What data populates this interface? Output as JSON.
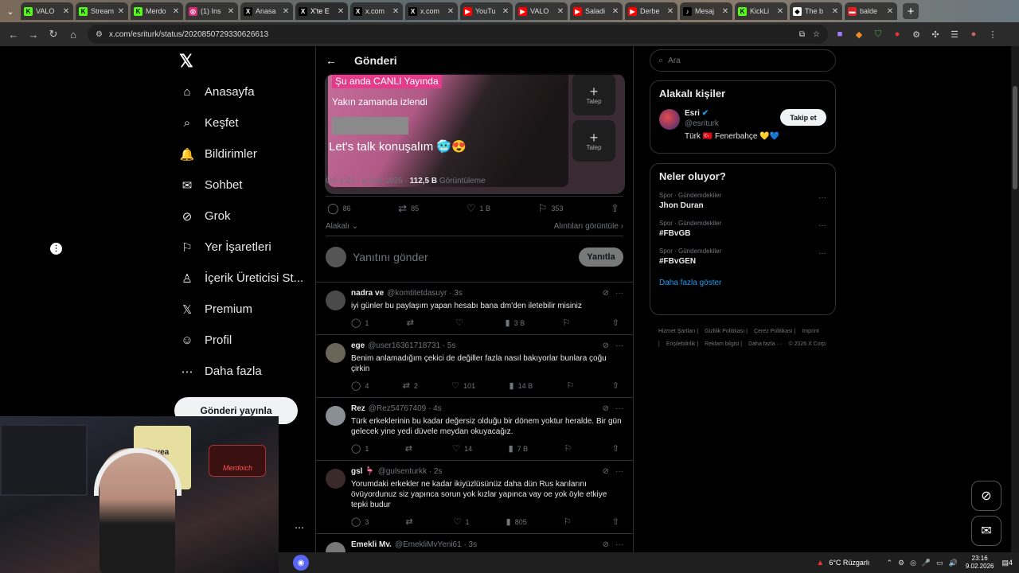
{
  "browser": {
    "tabs": [
      {
        "title": "VALO",
        "fav_bg": "#53fc18",
        "fav_text": "K"
      },
      {
        "title": "Stream",
        "fav_bg": "#53fc18",
        "fav_text": "K"
      },
      {
        "title": "Merdo",
        "fav_bg": "#53fc18",
        "fav_text": "K"
      },
      {
        "title": "(1) Ins",
        "fav_bg": "#d62976",
        "fav_text": "◎"
      },
      {
        "title": "Anasa",
        "fav_bg": "#000000",
        "fav_text": "X"
      },
      {
        "title": "X'te E",
        "fav_bg": "#000000",
        "fav_text": "X",
        "active": true
      },
      {
        "title": "x.com",
        "fav_bg": "#000000",
        "fav_text": "X"
      },
      {
        "title": "x.com",
        "fav_bg": "#000000",
        "fav_text": "X"
      },
      {
        "title": "YouTu",
        "fav_bg": "#ff0000",
        "fav_text": "▶"
      },
      {
        "title": "VALO",
        "fav_bg": "#ff0000",
        "fav_text": "▶"
      },
      {
        "title": "Saladi",
        "fav_bg": "#ff0000",
        "fav_text": "▶"
      },
      {
        "title": "Derbe",
        "fav_bg": "#ff0000",
        "fav_text": "▶"
      },
      {
        "title": "Mesaj",
        "fav_bg": "#000000",
        "fav_text": "♪"
      },
      {
        "title": "KickLi",
        "fav_bg": "#53fc18",
        "fav_text": "K"
      },
      {
        "title": "The b",
        "fav_bg": "#ffffff",
        "fav_text": "◆"
      },
      {
        "title": "balde",
        "fav_bg": "#e02020",
        "fav_text": "▬"
      }
    ],
    "url": "x.com/esriturk/status/2020850729330626613"
  },
  "nav": {
    "items": [
      {
        "label": "Anasayfa",
        "icon": "⌂",
        "name": "home"
      },
      {
        "label": "Keşfet",
        "icon": "⌕",
        "name": "explore"
      },
      {
        "label": "Bildirimler",
        "icon": "🔔",
        "name": "notifications"
      },
      {
        "label": "Sohbet",
        "icon": "✉",
        "name": "chat"
      },
      {
        "label": "Grok",
        "icon": "⊘",
        "name": "grok"
      },
      {
        "label": "Yer İşaretleri",
        "icon": "⚐",
        "name": "bookmarks"
      },
      {
        "label": "İçerik Üreticisi St...",
        "icon": "♙",
        "name": "creator-studio"
      },
      {
        "label": "Premium",
        "icon": "𝕏",
        "name": "premium"
      },
      {
        "label": "Profil",
        "icon": "☺",
        "name": "profile"
      },
      {
        "label": "Daha fazla",
        "icon": "⋯",
        "name": "more"
      }
    ],
    "post_button": "Gönderi yayınla"
  },
  "post": {
    "header_title": "Gönderi",
    "media": {
      "live": "Şu anda CANLI Yayında",
      "watched": "Yakın zamanda izlendi",
      "caption": "Let's talk  konuşalım 🥶😍",
      "request_label": "Talep"
    },
    "time": "ÖS 4:22 · 9 Şub 2026 · ",
    "views": "112,5 B",
    "views_label": "Görüntüleme",
    "stats": {
      "replies": "86",
      "reposts": "85",
      "likes": "1 B",
      "bookmarks": "353"
    },
    "related": "Alakalı",
    "quotes": "Alıntıları görüntüle",
    "reply_placeholder": "Yanıtını gönder",
    "reply_button": "Yanıtla"
  },
  "replies": [
    {
      "name": "nadra ve",
      "handle": "@komtitetdasuyr",
      "time": "· 3s",
      "text": "iyi günler bu paylaşım yapan hesabı bana dm'den iletebilir misiniz",
      "replies": "1",
      "reposts": "",
      "likes": "",
      "views": "3 B",
      "avatar": "#4a4a4a"
    },
    {
      "name": "ege",
      "handle": "@user16361718731",
      "time": "· 5s",
      "text": "Benim anlamadığım çekici de değiller fazla nasıl bakıyorlar bunlara çoğu çirkin",
      "replies": "4",
      "reposts": "2",
      "likes": "101",
      "views": "14 B",
      "avatar": "#6b6458"
    },
    {
      "name": "Rez",
      "handle": "@Rez54767409",
      "time": "· 4s",
      "text": "Türk erkeklerinin bu kadar değersiz olduğu bir dönem yoktur heralde. Bir gün gelecek yine yedi düvele meydan okuyacağız.",
      "replies": "1",
      "reposts": "",
      "likes": "14",
      "views": "7 B",
      "avatar": "#8a8f96"
    },
    {
      "name": "gsl 🦩",
      "handle": "@gulsenturkk",
      "time": "· 2s",
      "text": "Yorumdaki erkekler ne kadar ikiyüzlüsünüz daha dün Rus karılarını övüyordunuz siz yapınca sorun yok kızlar yapınca vay oe yok öyle etkiye tepki budur",
      "replies": "3",
      "reposts": "",
      "likes": "1",
      "views": "805",
      "avatar": "#3a2a2a"
    },
    {
      "name": "Emekli Mv.",
      "handle": "@EmekliMvYeni61",
      "time": "· 3s",
      "text": "",
      "replies": "",
      "reposts": "",
      "likes": "",
      "views": "",
      "avatar": "#777777"
    }
  ],
  "right": {
    "search_placeholder": "Ara",
    "people_title": "Alakalı kişiler",
    "person": {
      "name": "Esri",
      "handle": "@esriturk",
      "bio": "Türk 🇹🇷 Fenerbahçe 💛💙",
      "follow": "Takip et"
    },
    "trends_title": "Neler oluyor?",
    "trends": [
      {
        "category": "Spor · Gündemdekiler",
        "name": "Jhon Duran"
      },
      {
        "category": "Spor · Gündemdekiler",
        "name": "#FBvGB"
      },
      {
        "category": "Spor · Gündemdekiler",
        "name": "#FBvGEN"
      }
    ],
    "more": "Daha fazla göster",
    "footer": [
      "Hizmet Şartları |",
      "Gizlilik Politikası |",
      "Çerez Politikası |",
      "Imprint |",
      "Erişilebilirlik |",
      "Reklam bilgisi |",
      "Daha fazla ···",
      "© 2026 X Corp."
    ]
  },
  "webcam": {
    "jersey": "avea",
    "sign": "Merdoich"
  },
  "taskbar": {
    "weather": "6°C  Rüzgarlı",
    "time": "23:16",
    "date": "9.02.2026",
    "notif": "4"
  }
}
